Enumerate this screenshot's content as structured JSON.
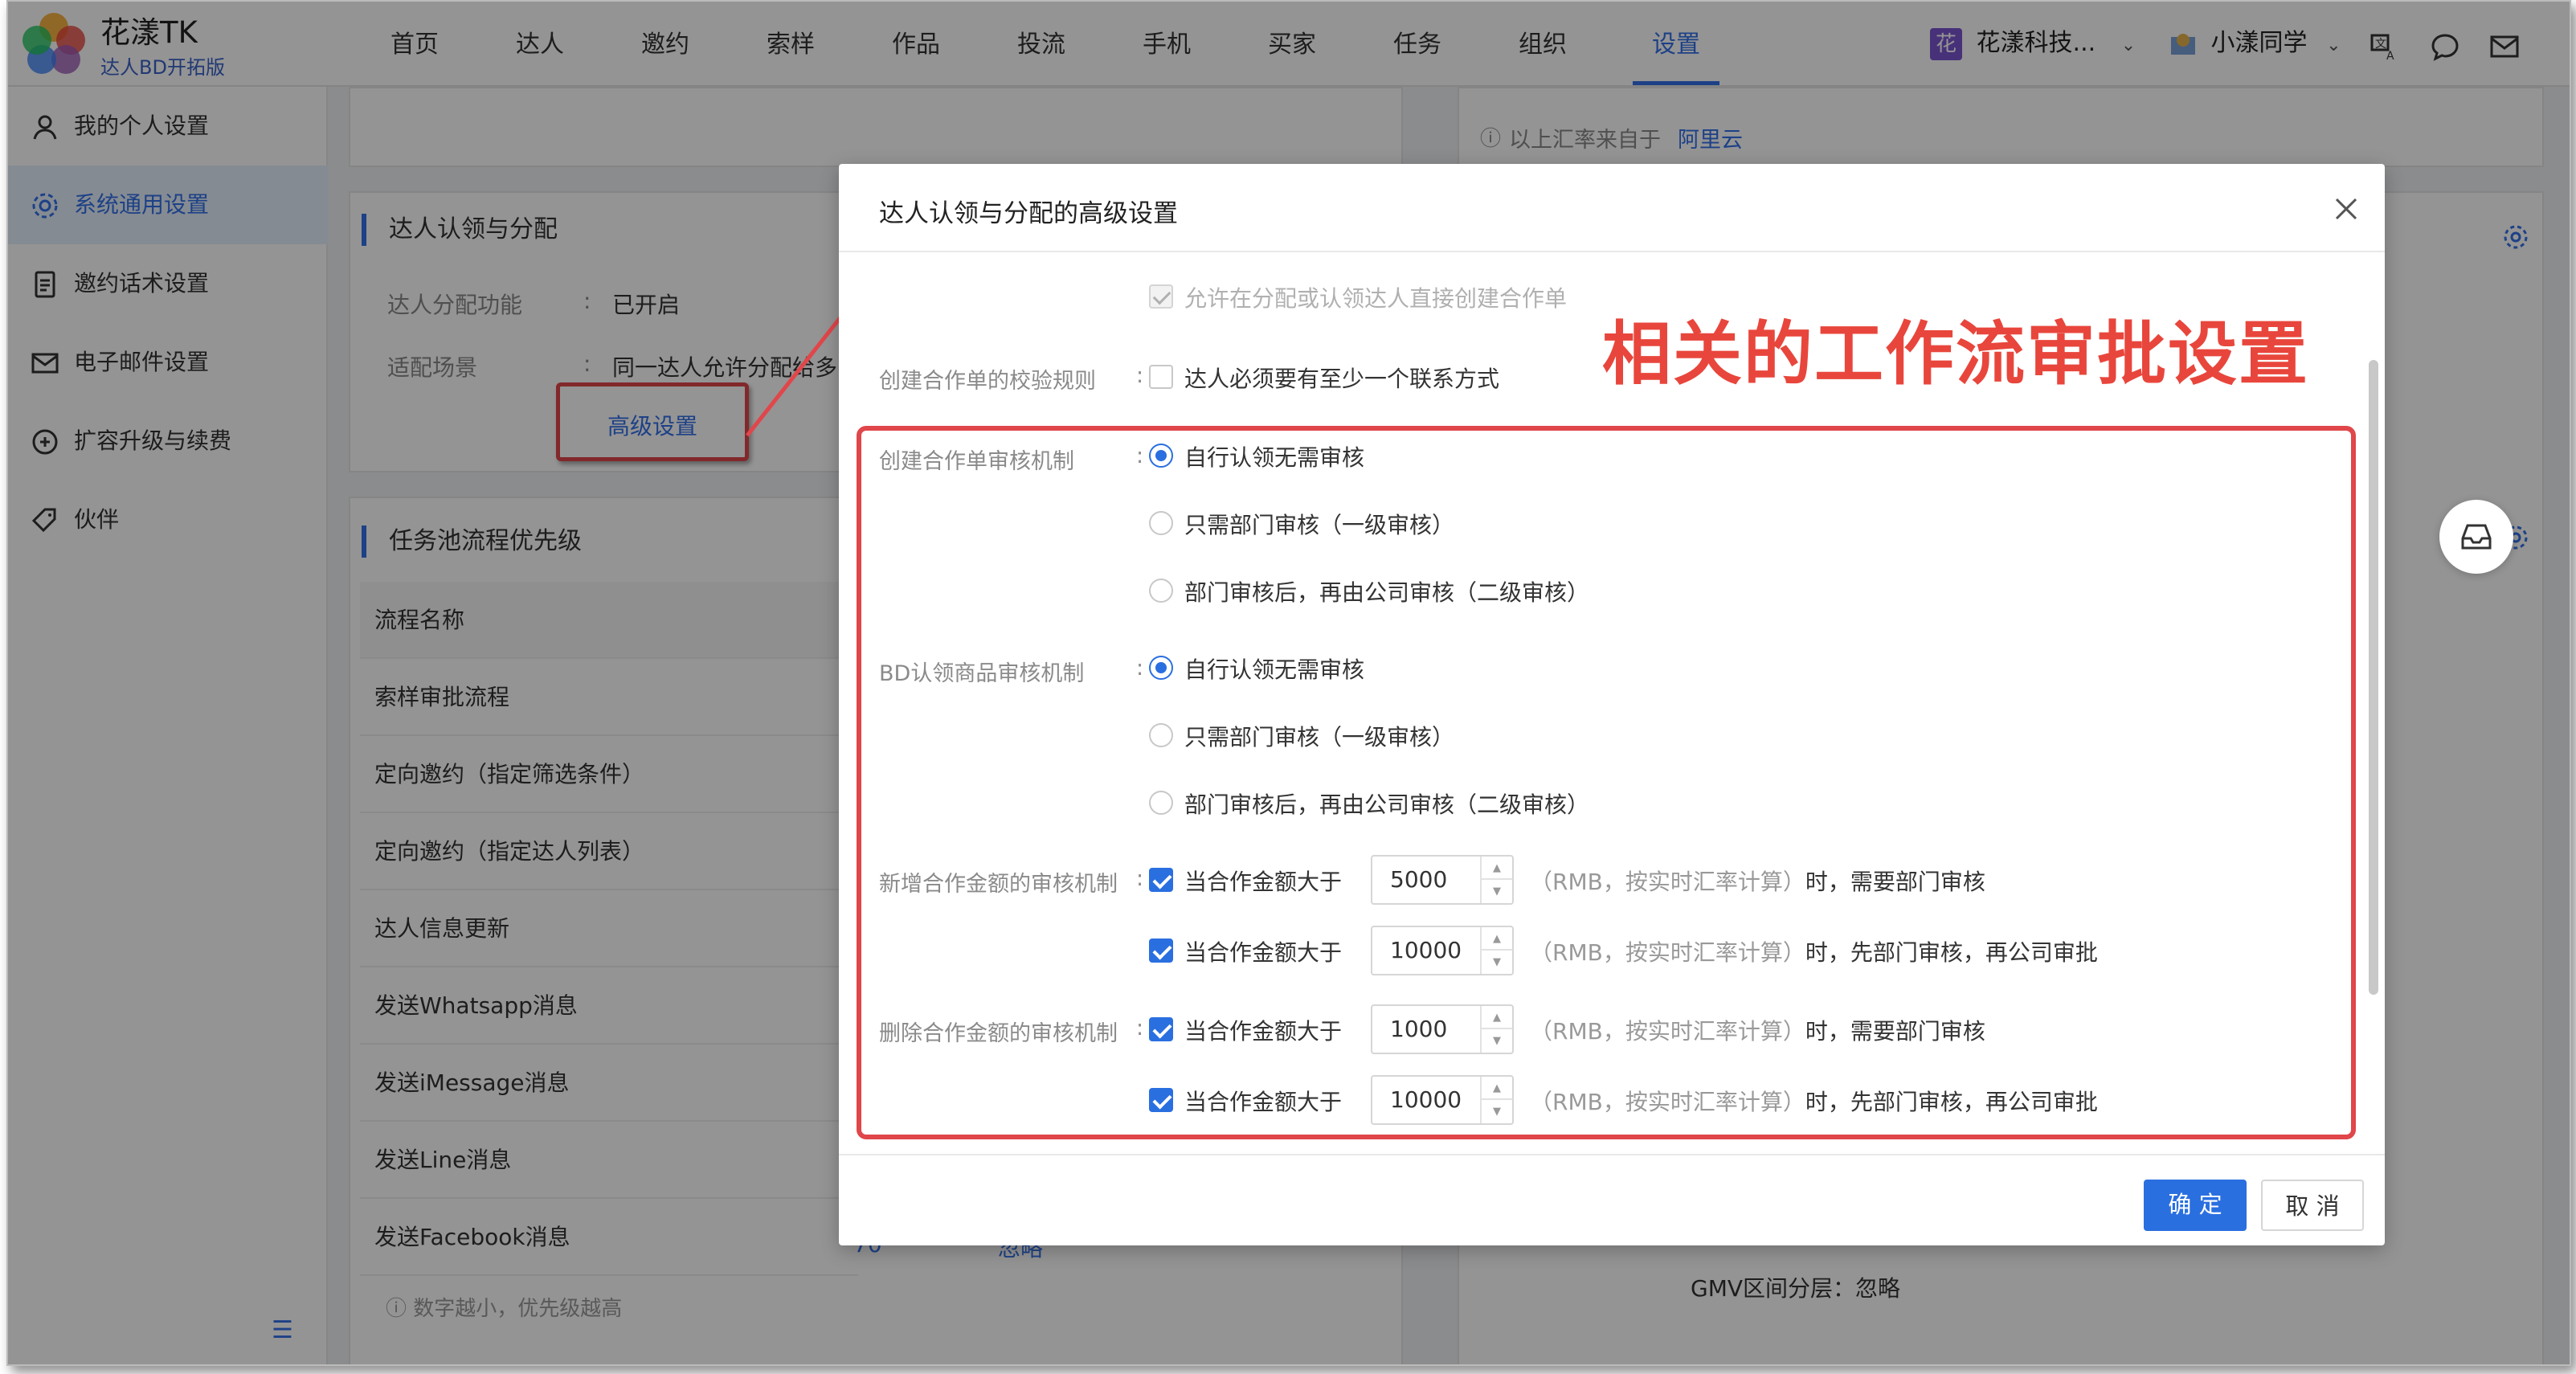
{
  "app": {
    "name": "花漾TK",
    "subtitle": "达人BD开拓版"
  },
  "nav": {
    "items": [
      "首页",
      "达人",
      "邀约",
      "索样",
      "作品",
      "投流",
      "手机",
      "买家",
      "任务",
      "组织",
      "设置"
    ],
    "active": "设置"
  },
  "topright": {
    "org_badge": "花",
    "org_name": "花漾科技...",
    "user_name": "小漾同学"
  },
  "sidebar": {
    "items": [
      "我的个人设置",
      "系统通用设置",
      "邀约话术设置",
      "电子邮件设置",
      "扩容升级与续费",
      "伙伴"
    ],
    "active_index": 1
  },
  "bg": {
    "rate_note": "以上汇率来自于",
    "rate_source": "阿里云",
    "section1_title": "达人认领与分配",
    "assign_label": "达人分配功能",
    "assign_value": "已开启",
    "scene_label": "适配场景",
    "scene_value": "同一达人允许分配给多",
    "advanced_link": "高级设置",
    "section2_title": "任务池流程优先级",
    "table_header": "流程名称",
    "rows": [
      "索样审批流程",
      "定向邀约（指定筛选条件）",
      "定向邀约（指定达人列表）",
      "达人信息更新",
      "发送Whatsapp消息",
      "发送iMessage消息",
      "发送Line消息",
      "发送Facebook消息"
    ],
    "last_row_num": "70",
    "last_row_action": "忽略",
    "footer_note": "数字越小，优先级越高",
    "gmv_note": "GMV区间分层：忽略"
  },
  "modal": {
    "title": "达人认领与分配的高级设置",
    "allow_create": "允许在分配或认领达人直接创建合作单",
    "validate_label": "创建合作单的校验规则",
    "validate_opt": "达人必须要有至少一个联系方式",
    "create_label": "创建合作单审核机制",
    "bd_label": "BD认领商品审核机制",
    "radio_opts": [
      "自行认领无需审核",
      "只需部门审核（一级审核）",
      "部门审核后，再由公司审核（二级审核）"
    ],
    "add_label": "新增合作金额的审核机制",
    "del_label": "删除合作金额的审核机制",
    "amount_text": "当合作金额大于",
    "values": [
      "5000",
      "10000",
      "1000",
      "10000"
    ],
    "rmb_note": "（RMB，按实时汇率计算）",
    "dept_note": "时，需要部门审核",
    "both_note": "时，先部门审核，再公司审批",
    "ok": "确 定",
    "cancel": "取 消"
  },
  "annotation": "相关的工作流审批设置",
  "colors": {
    "accent": "#2a6fe0",
    "annotation": "#e0464a"
  }
}
